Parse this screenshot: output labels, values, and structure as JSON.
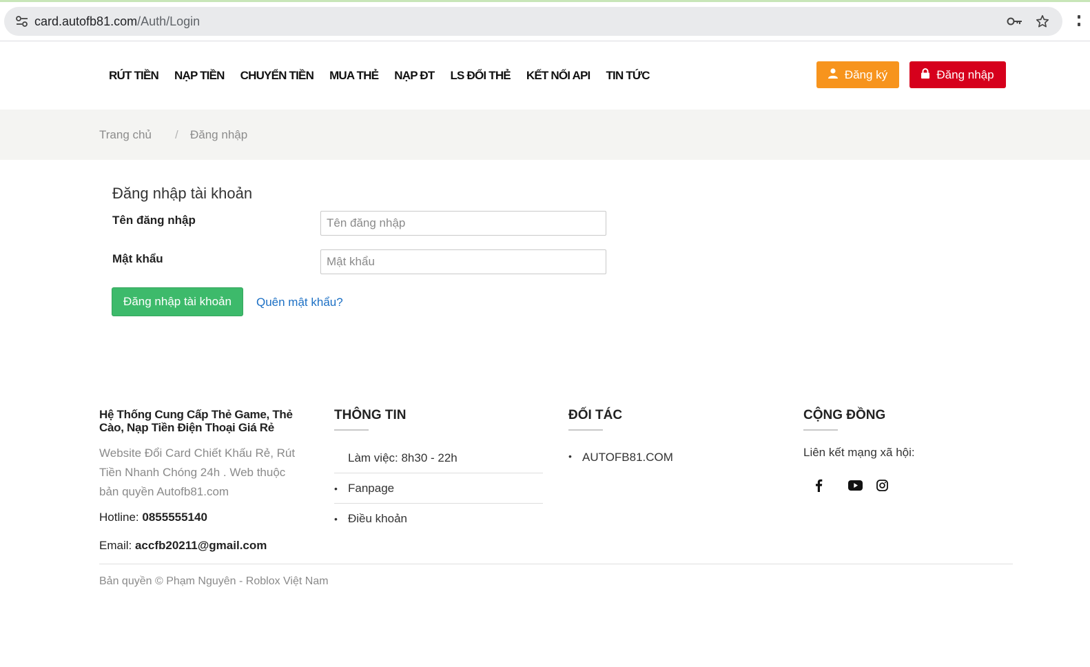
{
  "browser": {
    "url_host": "card.autofb81.com",
    "url_path": "/Auth/Login",
    "icons": [
      "site-settings-icon",
      "password-key-icon",
      "bookmark-star-icon"
    ]
  },
  "nav": {
    "items": [
      "RÚT TIỀN",
      "NẠP TIỀN",
      "CHUYỂN TIỀN",
      "MUA THẺ",
      "NẠP ĐT",
      "LS ĐỔI THẺ",
      "KẾT NỐI API",
      "TIN TỨC"
    ],
    "register_label": "Đăng ký",
    "login_label": "Đăng nhập"
  },
  "breadcrumb": {
    "home": "Trang chủ",
    "separator": "/",
    "current": "Đăng nhập"
  },
  "form": {
    "title": "Đăng nhập tài khoản",
    "username_label": "Tên đăng nhập",
    "username_placeholder": "Tên đăng nhập",
    "password_label": "Mật khẩu",
    "password_placeholder": "Mật khẩu",
    "submit_label": "Đăng nhập tài khoản",
    "forgot_label": "Quên mật khẩu?"
  },
  "footer": {
    "about_title": "Hệ Thống Cung Cấp Thẻ Game, Thẻ Cào, Nạp Tiền Điện Thoại Giá Rẻ",
    "about_desc": "Website Đổi Card Chiết Khấu Rẻ, Rút Tiền Nhanh Chóng 24h . Web thuộc bản quyền Autofb81.com",
    "hotline_label": "Hotline: ",
    "hotline": "0855555140",
    "email_label": "Email: ",
    "email": "accfb20211@gmail.com",
    "info_title": "THÔNG TIN",
    "info_items": [
      "Làm việc: 8h30 - 22h",
      "Fanpage",
      "Điều khoản"
    ],
    "partner_title": "ĐỐI TÁC",
    "partners": [
      "AUTOFB81.COM"
    ],
    "community_title": "CỘNG ĐỒNG",
    "social_label": "Liên kết mạng xã hội:",
    "social_icons": [
      "facebook-icon",
      "youtube-icon",
      "instagram-icon"
    ],
    "copyright": "Bản quyền © Phạm Nguyên - Roblox Việt Nam"
  },
  "colors": {
    "register": "#f7941d",
    "login": "#d6001c",
    "submit": "#3dba6b",
    "link": "#1b6fc4"
  }
}
